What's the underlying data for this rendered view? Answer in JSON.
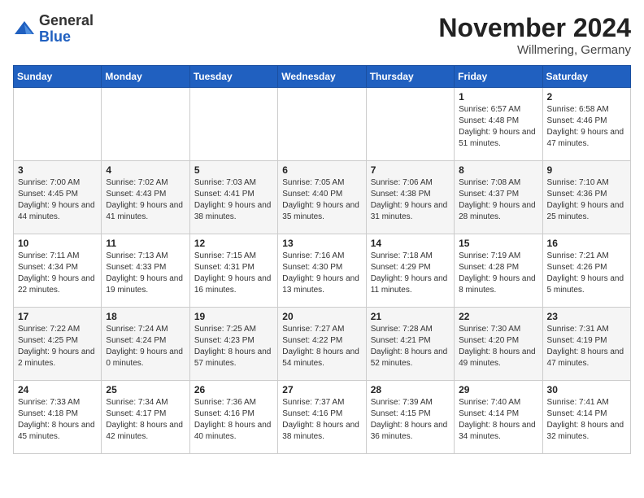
{
  "logo": {
    "general": "General",
    "blue": "Blue"
  },
  "header": {
    "month_title": "November 2024",
    "location": "Willmering, Germany"
  },
  "days_of_week": [
    "Sunday",
    "Monday",
    "Tuesday",
    "Wednesday",
    "Thursday",
    "Friday",
    "Saturday"
  ],
  "weeks": [
    [
      {
        "day": "",
        "info": ""
      },
      {
        "day": "",
        "info": ""
      },
      {
        "day": "",
        "info": ""
      },
      {
        "day": "",
        "info": ""
      },
      {
        "day": "",
        "info": ""
      },
      {
        "day": "1",
        "info": "Sunrise: 6:57 AM\nSunset: 4:48 PM\nDaylight: 9 hours and 51 minutes."
      },
      {
        "day": "2",
        "info": "Sunrise: 6:58 AM\nSunset: 4:46 PM\nDaylight: 9 hours and 47 minutes."
      }
    ],
    [
      {
        "day": "3",
        "info": "Sunrise: 7:00 AM\nSunset: 4:45 PM\nDaylight: 9 hours and 44 minutes."
      },
      {
        "day": "4",
        "info": "Sunrise: 7:02 AM\nSunset: 4:43 PM\nDaylight: 9 hours and 41 minutes."
      },
      {
        "day": "5",
        "info": "Sunrise: 7:03 AM\nSunset: 4:41 PM\nDaylight: 9 hours and 38 minutes."
      },
      {
        "day": "6",
        "info": "Sunrise: 7:05 AM\nSunset: 4:40 PM\nDaylight: 9 hours and 35 minutes."
      },
      {
        "day": "7",
        "info": "Sunrise: 7:06 AM\nSunset: 4:38 PM\nDaylight: 9 hours and 31 minutes."
      },
      {
        "day": "8",
        "info": "Sunrise: 7:08 AM\nSunset: 4:37 PM\nDaylight: 9 hours and 28 minutes."
      },
      {
        "day": "9",
        "info": "Sunrise: 7:10 AM\nSunset: 4:36 PM\nDaylight: 9 hours and 25 minutes."
      }
    ],
    [
      {
        "day": "10",
        "info": "Sunrise: 7:11 AM\nSunset: 4:34 PM\nDaylight: 9 hours and 22 minutes."
      },
      {
        "day": "11",
        "info": "Sunrise: 7:13 AM\nSunset: 4:33 PM\nDaylight: 9 hours and 19 minutes."
      },
      {
        "day": "12",
        "info": "Sunrise: 7:15 AM\nSunset: 4:31 PM\nDaylight: 9 hours and 16 minutes."
      },
      {
        "day": "13",
        "info": "Sunrise: 7:16 AM\nSunset: 4:30 PM\nDaylight: 9 hours and 13 minutes."
      },
      {
        "day": "14",
        "info": "Sunrise: 7:18 AM\nSunset: 4:29 PM\nDaylight: 9 hours and 11 minutes."
      },
      {
        "day": "15",
        "info": "Sunrise: 7:19 AM\nSunset: 4:28 PM\nDaylight: 9 hours and 8 minutes."
      },
      {
        "day": "16",
        "info": "Sunrise: 7:21 AM\nSunset: 4:26 PM\nDaylight: 9 hours and 5 minutes."
      }
    ],
    [
      {
        "day": "17",
        "info": "Sunrise: 7:22 AM\nSunset: 4:25 PM\nDaylight: 9 hours and 2 minutes."
      },
      {
        "day": "18",
        "info": "Sunrise: 7:24 AM\nSunset: 4:24 PM\nDaylight: 9 hours and 0 minutes."
      },
      {
        "day": "19",
        "info": "Sunrise: 7:25 AM\nSunset: 4:23 PM\nDaylight: 8 hours and 57 minutes."
      },
      {
        "day": "20",
        "info": "Sunrise: 7:27 AM\nSunset: 4:22 PM\nDaylight: 8 hours and 54 minutes."
      },
      {
        "day": "21",
        "info": "Sunrise: 7:28 AM\nSunset: 4:21 PM\nDaylight: 8 hours and 52 minutes."
      },
      {
        "day": "22",
        "info": "Sunrise: 7:30 AM\nSunset: 4:20 PM\nDaylight: 8 hours and 49 minutes."
      },
      {
        "day": "23",
        "info": "Sunrise: 7:31 AM\nSunset: 4:19 PM\nDaylight: 8 hours and 47 minutes."
      }
    ],
    [
      {
        "day": "24",
        "info": "Sunrise: 7:33 AM\nSunset: 4:18 PM\nDaylight: 8 hours and 45 minutes."
      },
      {
        "day": "25",
        "info": "Sunrise: 7:34 AM\nSunset: 4:17 PM\nDaylight: 8 hours and 42 minutes."
      },
      {
        "day": "26",
        "info": "Sunrise: 7:36 AM\nSunset: 4:16 PM\nDaylight: 8 hours and 40 minutes."
      },
      {
        "day": "27",
        "info": "Sunrise: 7:37 AM\nSunset: 4:16 PM\nDaylight: 8 hours and 38 minutes."
      },
      {
        "day": "28",
        "info": "Sunrise: 7:39 AM\nSunset: 4:15 PM\nDaylight: 8 hours and 36 minutes."
      },
      {
        "day": "29",
        "info": "Sunrise: 7:40 AM\nSunset: 4:14 PM\nDaylight: 8 hours and 34 minutes."
      },
      {
        "day": "30",
        "info": "Sunrise: 7:41 AM\nSunset: 4:14 PM\nDaylight: 8 hours and 32 minutes."
      }
    ]
  ]
}
